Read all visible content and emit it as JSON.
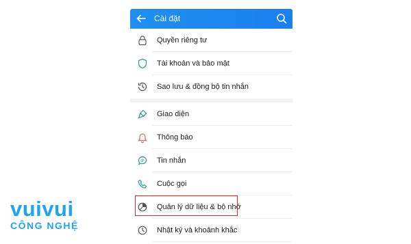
{
  "header": {
    "title": "Cài đặt",
    "back_icon": "arrow-left-icon",
    "search_icon": "search-icon"
  },
  "items": [
    {
      "label": "Quyền riêng tư",
      "icon": "lock-icon"
    },
    {
      "label": "Tài khoản và bảo mật",
      "icon": "shield-icon"
    },
    {
      "label": "Sao lưu & đồng bộ tin nhắn",
      "icon": "history-icon"
    },
    {
      "label": "Giao diện",
      "icon": "brush-icon"
    },
    {
      "label": "Thông báo",
      "icon": "bell-icon"
    },
    {
      "label": "Tin nhắn",
      "icon": "chat-icon"
    },
    {
      "label": "Cuộc gọi",
      "icon": "phone-icon"
    },
    {
      "label": "Quản lý dữ liệu & bộ nhớ",
      "icon": "pie-chart-icon"
    },
    {
      "label": "Nhật ký và khoảnh khắc",
      "icon": "clock-icon"
    }
  ],
  "watermark": {
    "line1": "vuivui",
    "line2": "CÔNG NGHỆ"
  },
  "colors": {
    "header": "#1e8ff0",
    "icon": "#2aa089",
    "highlight": "#e0252b",
    "brand": "#1da4f2"
  }
}
